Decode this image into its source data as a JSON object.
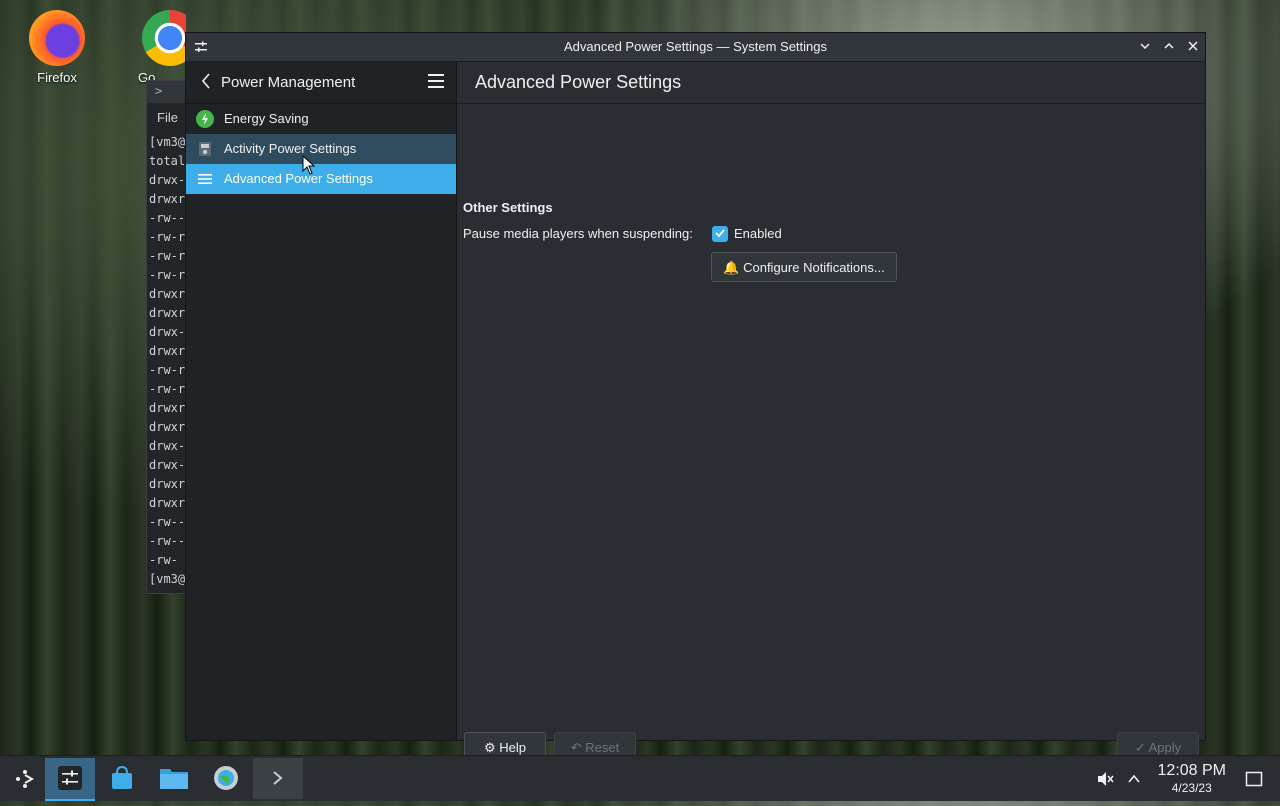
{
  "desktop": {
    "icons": [
      {
        "label": "Firefox"
      },
      {
        "label": "Go"
      }
    ]
  },
  "terminal": {
    "menu_file": "File",
    "lines": [
      "[vm3@",
      "total",
      "drwx-",
      "drwxr",
      "-rw--",
      "-rw-r",
      "-rw-r",
      "-rw-r",
      "drwxr",
      "drwxr",
      "drwx-",
      "drwxr",
      "-rw-r",
      "-rw-r",
      "drwxr",
      "drwxr",
      "drwx-",
      "drwx-",
      "drwxr",
      "drwxr",
      "-rw--",
      "-rw--",
      "-rw-",
      "[vm3@"
    ]
  },
  "window": {
    "title": "Advanced Power Settings — System Settings"
  },
  "sidebar": {
    "header": "Power Management",
    "items": [
      {
        "label": "Energy Saving",
        "icon": "energy-icon"
      },
      {
        "label": "Activity Power Settings",
        "icon": "activity-icon"
      },
      {
        "label": "Advanced Power Settings",
        "icon": "list-icon"
      }
    ]
  },
  "content": {
    "page_title": "Advanced Power Settings",
    "section_title": "Other Settings",
    "pause_label": "Pause media players when suspending:",
    "enabled_label": "Enabled",
    "enabled_checked": true,
    "configure_button": "Configure Notifications...",
    "help_button": "Help",
    "reset_button": "Reset",
    "apply_button": "Apply"
  },
  "taskbar": {
    "time": "12:08 PM",
    "date": "4/23/23"
  },
  "colors": {
    "accent": "#3daee9",
    "window_bg": "#2a2e32",
    "sidebar_bg": "#202326"
  }
}
